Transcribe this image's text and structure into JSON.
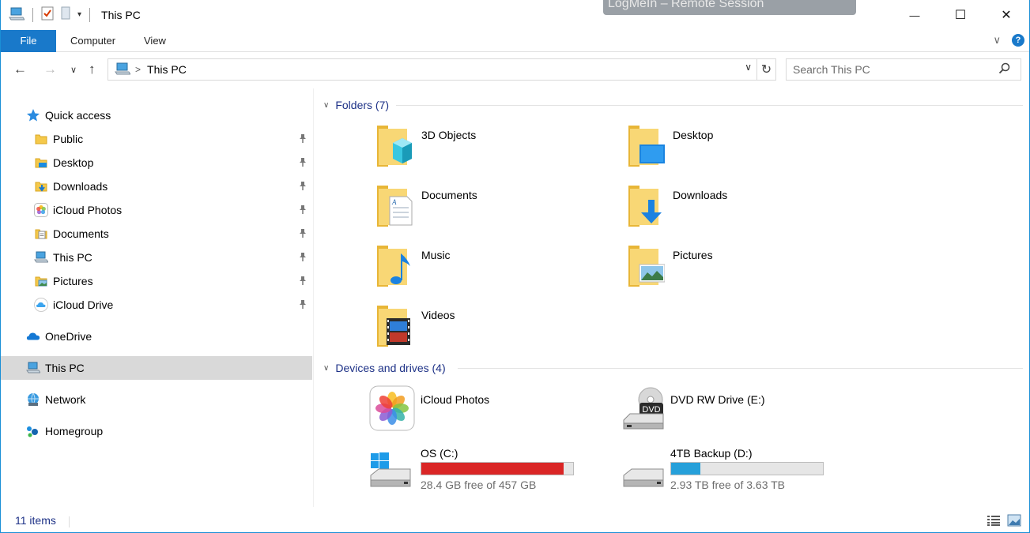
{
  "window": {
    "title": "This PC",
    "overlay_text": "LogMeIn – Remote Session",
    "minimize": "—",
    "maximize": "☐",
    "close": "✕"
  },
  "ribbon": {
    "file_tab": "File",
    "computer_tab": "Computer",
    "view_tab": "View",
    "help": "?"
  },
  "address": {
    "crumb": "This PC",
    "search_placeholder": "Search This PC"
  },
  "sidebar": {
    "quick_access": "Quick access",
    "pinned": [
      {
        "label": "Public",
        "icon": "folder-icon"
      },
      {
        "label": "Desktop",
        "icon": "desktop-folder-icon"
      },
      {
        "label": "Downloads",
        "icon": "downloads-folder-icon"
      },
      {
        "label": "iCloud Photos",
        "icon": "icloud-photos-icon"
      },
      {
        "label": "Documents",
        "icon": "documents-folder-icon"
      },
      {
        "label": "This PC",
        "icon": "computer-icon"
      },
      {
        "label": "Pictures",
        "icon": "pictures-folder-icon"
      },
      {
        "label": "iCloud Drive",
        "icon": "icloud-drive-icon"
      }
    ],
    "onedrive": "OneDrive",
    "this_pc": "This PC",
    "network": "Network",
    "homegroup": "Homegroup"
  },
  "content": {
    "folders_header": "Folders (7)",
    "folders": [
      {
        "label": "3D Objects",
        "icon": "3d-objects-folder-icon"
      },
      {
        "label": "Desktop",
        "icon": "desktop-folder-icon"
      },
      {
        "label": "Documents",
        "icon": "documents-folder-icon"
      },
      {
        "label": "Downloads",
        "icon": "downloads-folder-icon"
      },
      {
        "label": "Music",
        "icon": "music-folder-icon"
      },
      {
        "label": "Pictures",
        "icon": "pictures-folder-icon"
      },
      {
        "label": "Videos",
        "icon": "videos-folder-icon"
      }
    ],
    "devices_header": "Devices and drives (4)",
    "devices": [
      {
        "label": "iCloud Photos",
        "icon": "icloud-photos-icon"
      },
      {
        "label": "DVD RW Drive (E:)",
        "icon": "dvd-drive-icon",
        "badge": "DVD"
      },
      {
        "label": "OS (C:)",
        "icon": "windows-drive-icon",
        "free": "28.4 GB free of 457 GB",
        "used_fraction": 0.938,
        "bar_color": "#da2626"
      },
      {
        "label": "4TB Backup (D:)",
        "icon": "hard-drive-icon",
        "free": "2.93 TB free of 3.63 TB",
        "used_fraction": 0.193,
        "bar_color": "#26a0da"
      }
    ]
  },
  "status": {
    "count": "11 items"
  },
  "colors": {
    "accent": "#1979ca",
    "folder": "#f5c94b",
    "header_text": "#1e3287"
  }
}
